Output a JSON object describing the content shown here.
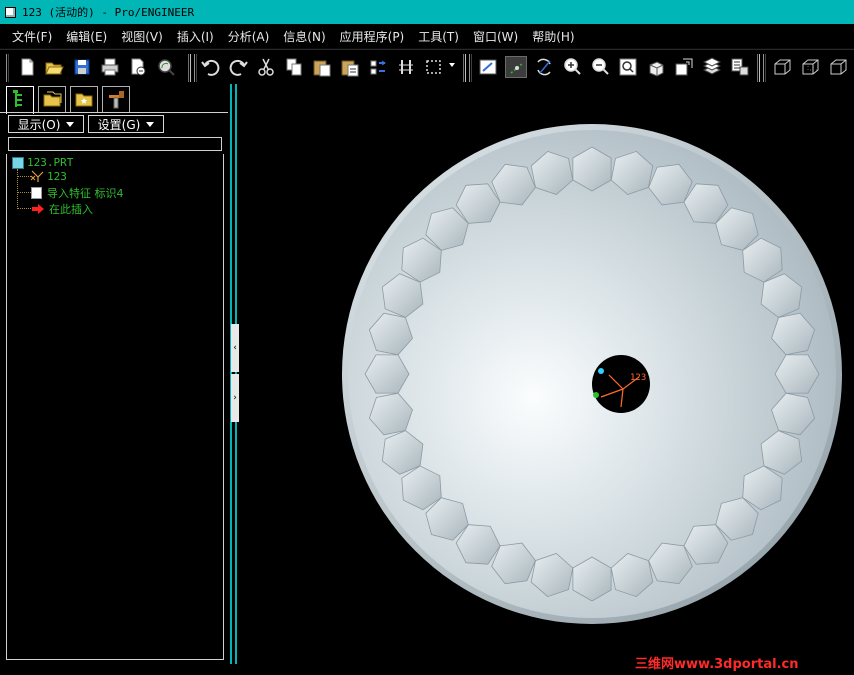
{
  "window": {
    "title": "123 (活动的) - Pro/ENGINEER"
  },
  "menu": [
    "文件(F)",
    "编辑(E)",
    "视图(V)",
    "插入(I)",
    "分析(A)",
    "信息(N)",
    "应用程序(P)",
    "工具(T)",
    "窗口(W)",
    "帮助(H)"
  ],
  "toolbar": {
    "file_group": [
      "new-icon",
      "open-icon",
      "save-icon",
      "print-icon",
      "send-mail-icon",
      "search-icon"
    ],
    "edit_group": [
      "undo-icon",
      "redo-icon",
      "cut-icon",
      "copy-icon",
      "paste-icon",
      "paste-special-icon",
      "regenerate-icon",
      "model-tree-icon",
      "select-box-icon"
    ],
    "view_group": [
      "repaint-icon",
      "spin-center-icon",
      "orient-icon",
      "zoom-in-icon",
      "zoom-out-icon",
      "refit-icon",
      "view-icon",
      "saved-views-icon",
      "layers-icon",
      "view-manager-icon"
    ],
    "display_group": [
      "wireframe-icon",
      "hidden-line-icon",
      "no-hidden-icon"
    ],
    "pressed": "spin-center-icon"
  },
  "panel": {
    "tabs": [
      "model-tree-tab-icon",
      "folder-browser-tab-icon",
      "favorites-tab-icon",
      "connections-tab-icon"
    ],
    "show_button": "显示(O)",
    "settings_button": "设置(G)",
    "filter_value": ""
  },
  "tree": {
    "root": "123.PRT",
    "items": [
      {
        "label": "123",
        "icon": "coordinate-system-icon"
      },
      {
        "label": "导入特征 标识4",
        "icon": "import-feature-icon"
      },
      {
        "label": "在此插入",
        "icon": "insert-here-arrow-icon"
      }
    ]
  },
  "model": {
    "csys_label": "123",
    "colors": {
      "surface": "#b7c2c8",
      "highlight": "#ffffff",
      "shadow": "#8b979e",
      "tree_text": "#2fbf2f",
      "title_bar": "#00b6b6"
    }
  },
  "watermark": "三维网www.3dportal.cn"
}
